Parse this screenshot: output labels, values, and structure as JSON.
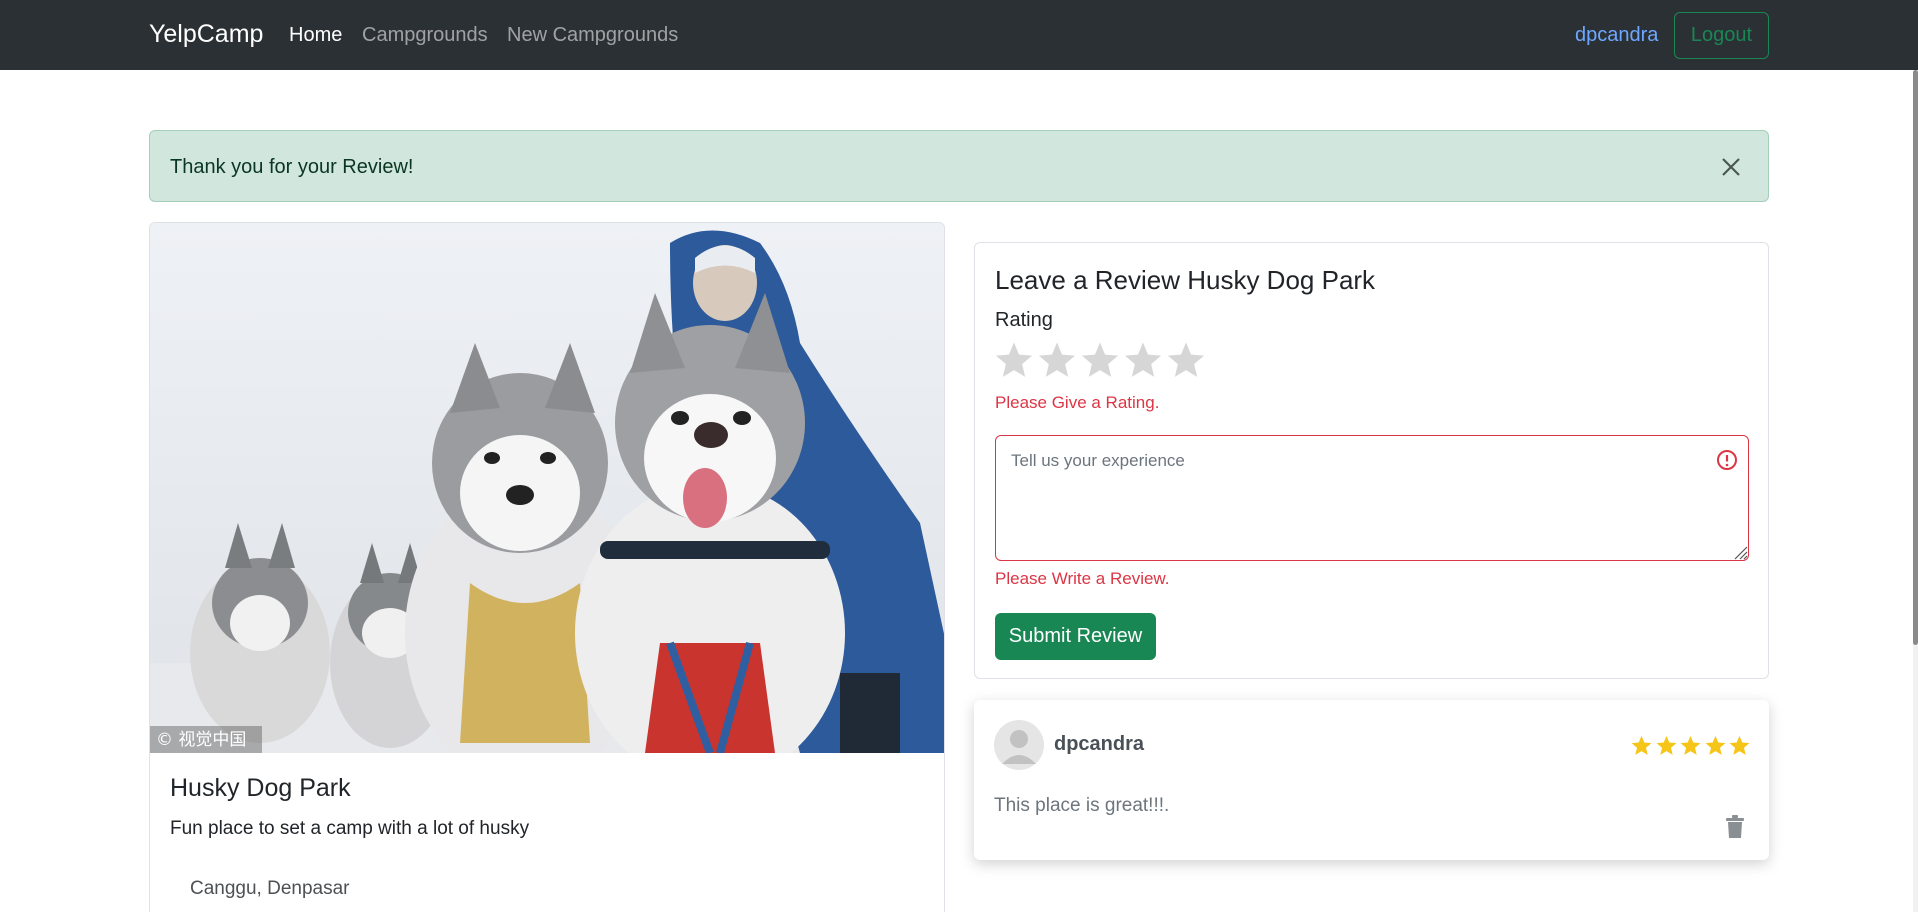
{
  "navbar": {
    "brand": "YelpCamp",
    "links": [
      {
        "label": "Home",
        "active": true
      },
      {
        "label": "Campgrounds",
        "active": false
      },
      {
        "label": "New Campgrounds",
        "active": false
      }
    ],
    "username": "dpcandra",
    "logout_label": "Logout"
  },
  "alert": {
    "message": "Thank you for your Review!",
    "close_icon": "close-icon"
  },
  "campground": {
    "image_watermark": "© 视觉中国",
    "title": "Husky Dog Park",
    "description": "Fun place to set a camp with a lot of husky",
    "location": "Canggu, Denpasar"
  },
  "review_form": {
    "heading": "Leave a Review Husky Dog Park",
    "rating_label": "Rating",
    "star_count": 5,
    "selected_rating": 0,
    "rating_error": "Please Give a Rating.",
    "textarea_placeholder": "Tell us your experience",
    "review_error": "Please Write a Review.",
    "submit_label": "Submit Review"
  },
  "reviews": [
    {
      "author": "dpcandra",
      "rating": 5,
      "body": "This place is great!!!."
    }
  ],
  "colors": {
    "navbar_bg": "#2b3035",
    "success": "#198754",
    "danger": "#dc3545",
    "alert_bg": "#d1e7dd",
    "star_gold": "#f5c518",
    "star_empty": "#d6d6d6",
    "link_blue": "#6ea8fe"
  }
}
